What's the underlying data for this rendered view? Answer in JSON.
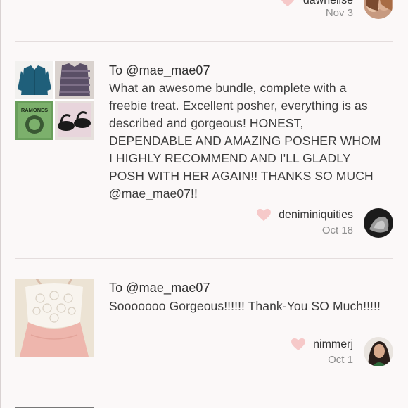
{
  "feed": {
    "partial": {
      "username": "dawnelise",
      "date": "Nov 3"
    },
    "items": [
      {
        "recipient": "To @mae_mae07",
        "comment": "What an awesome bundle, complete with a freebie treat. Excellent posher, everything is as described and gorgeous! HONEST, DEPENDABLE AND AMAZING POSHER WHOM I HIGHLY RECOMMEND AND I'LL GLADLY POSH WITH HER AGAIN!! THANKS SO MUCH @mae_mae07!!",
        "username": "deniminiquities",
        "date": "Oct 18",
        "thumb_text": "RAMONES"
      },
      {
        "recipient": "To @mae_mae07",
        "comment": "Sooooooo Gorgeous!!!!!! Thank-You SO Much!!!!!",
        "username": "nimmerj",
        "date": "Oct 1"
      }
    ]
  },
  "colors": {
    "heart": "#f6c9c9",
    "divider": "#e4dddd",
    "date": "#8f8f8f"
  }
}
